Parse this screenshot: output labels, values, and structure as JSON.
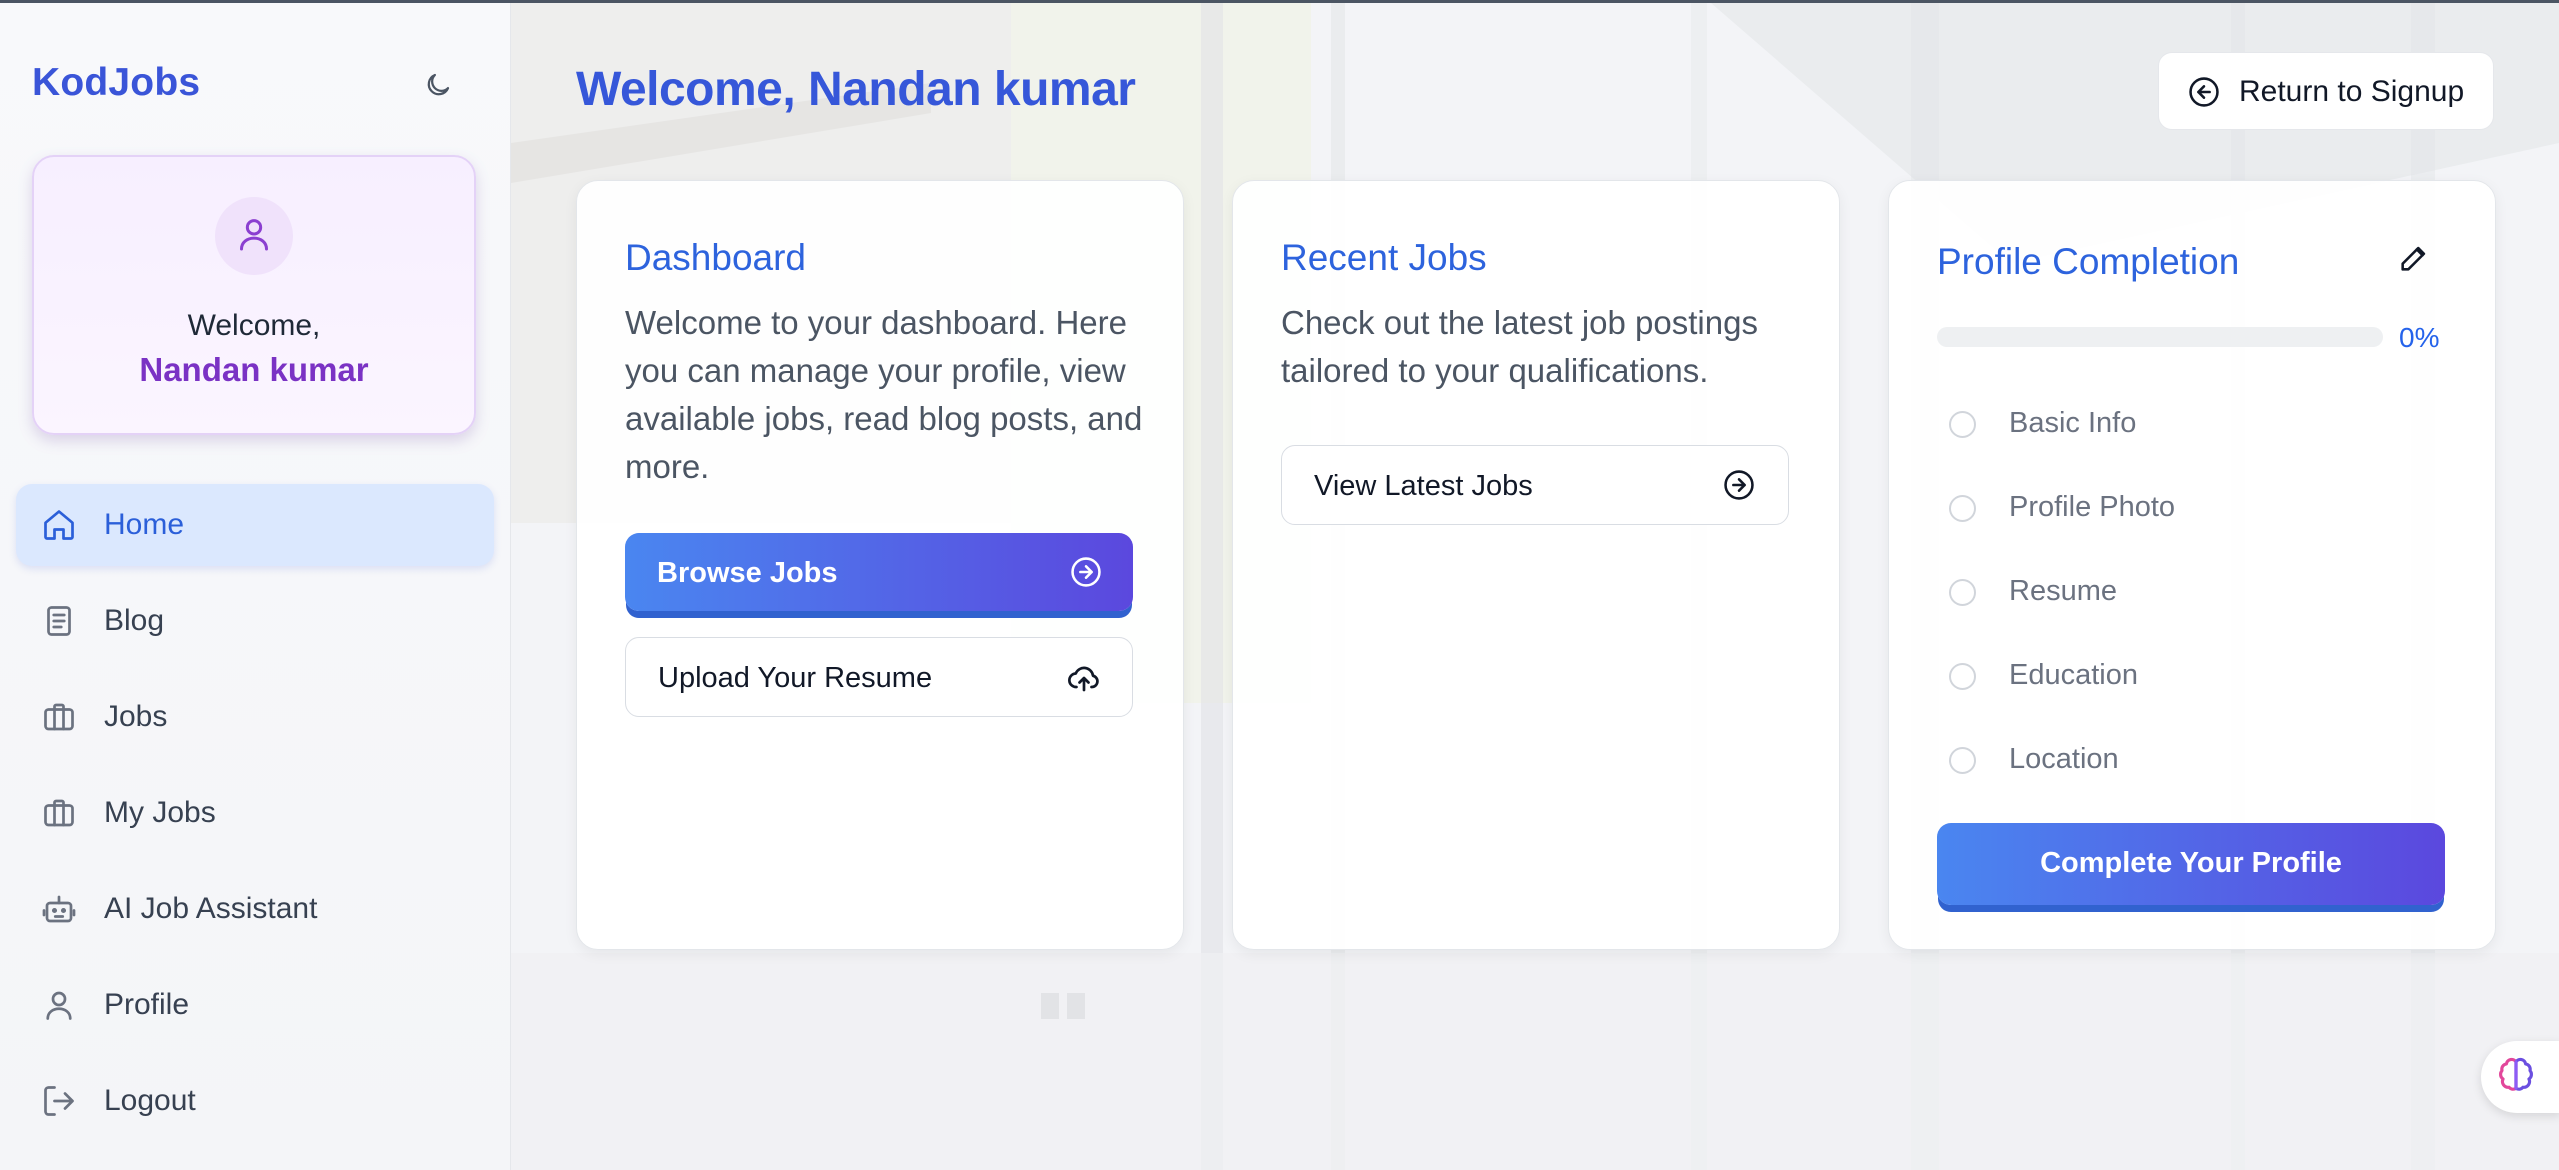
{
  "app": {
    "logo": "KodJobs",
    "theme_toggle_icon": "moon-icon"
  },
  "sidebar": {
    "welcome_label": "Welcome,",
    "user_name": "Nandan kumar",
    "items": [
      {
        "label": "Home",
        "icon": "home-icon",
        "active": true
      },
      {
        "label": "Blog",
        "icon": "document-icon",
        "active": false
      },
      {
        "label": "Jobs",
        "icon": "briefcase-icon",
        "active": false
      },
      {
        "label": "My Jobs",
        "icon": "briefcase-icon",
        "active": false
      },
      {
        "label": "AI Job Assistant",
        "icon": "bot-icon",
        "active": false
      },
      {
        "label": "Profile",
        "icon": "user-icon",
        "active": false
      },
      {
        "label": "Logout",
        "icon": "logout-icon",
        "active": false
      }
    ]
  },
  "header": {
    "title": "Welcome, Nandan kumar",
    "return_button": "Return to Signup"
  },
  "dashboard_card": {
    "title": "Dashboard",
    "text": "Welcome to your dashboard. Here you can manage your profile, view available jobs, read blog posts, and more.",
    "browse_button": "Browse Jobs",
    "upload_button": "Upload Your Resume"
  },
  "recent_jobs_card": {
    "title": "Recent Jobs",
    "text": "Check out the latest job postings tailored to your qualifications.",
    "view_button": "View Latest Jobs"
  },
  "profile_card": {
    "title": "Profile Completion",
    "progress": 0,
    "progress_label": "0%",
    "checklist": [
      "Basic Info",
      "Profile Photo",
      "Resume",
      "Education",
      "Location"
    ],
    "complete_button": "Complete Your Profile"
  },
  "colors": {
    "brand": "#3a55d8",
    "accent_blue": "#2d63dd",
    "purple_name": "#7a32c4",
    "active_nav_bg": "#dbe8fe"
  }
}
